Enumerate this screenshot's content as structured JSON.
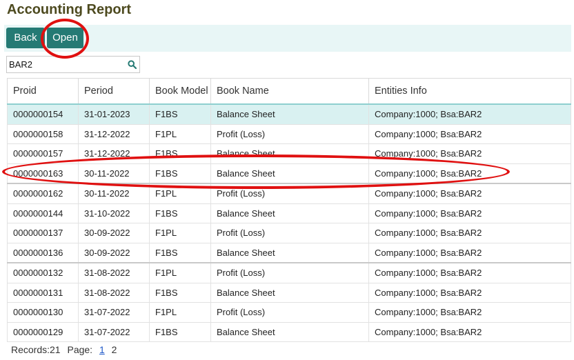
{
  "page": {
    "title": "Accounting Report"
  },
  "toolbar": {
    "back_label": "Back",
    "open_label": "Open"
  },
  "search": {
    "value": "BAR2"
  },
  "table": {
    "columns": [
      "Proid",
      "Period",
      "Book Model",
      "Book Name",
      "Entities Info"
    ],
    "rows": [
      [
        "0000000154",
        "31-01-2023",
        "F1BS",
        "Balance Sheet",
        "Company:1000; Bsa:BAR2"
      ],
      [
        "0000000158",
        "31-12-2022",
        "F1PL",
        "Profit (Loss)",
        "Company:1000; Bsa:BAR2"
      ],
      [
        "0000000157",
        "31-12-2022",
        "F1BS",
        "Balance Sheet",
        "Company:1000; Bsa:BAR2"
      ],
      [
        "0000000163",
        "30-11-2022",
        "F1BS",
        "Balance Sheet",
        "Company:1000; Bsa:BAR2"
      ],
      [
        "0000000162",
        "30-11-2022",
        "F1PL",
        "Profit (Loss)",
        "Company:1000; Bsa:BAR2"
      ],
      [
        "0000000144",
        "31-10-2022",
        "F1BS",
        "Balance Sheet",
        "Company:1000; Bsa:BAR2"
      ],
      [
        "0000000137",
        "30-09-2022",
        "F1PL",
        "Profit (Loss)",
        "Company:1000; Bsa:BAR2"
      ],
      [
        "0000000136",
        "30-09-2022",
        "F1BS",
        "Balance Sheet",
        "Company:1000; Bsa:BAR2"
      ],
      [
        "0000000132",
        "31-08-2022",
        "F1PL",
        "Profit (Loss)",
        "Company:1000; Bsa:BAR2"
      ],
      [
        "0000000131",
        "31-08-2022",
        "F1BS",
        "Balance Sheet",
        "Company:1000; Bsa:BAR2"
      ],
      [
        "0000000130",
        "31-07-2022",
        "F1PL",
        "Profit (Loss)",
        "Company:1000; Bsa:BAR2"
      ],
      [
        "0000000129",
        "31-07-2022",
        "F1BS",
        "Balance Sheet",
        "Company:1000; Bsa:BAR2"
      ]
    ]
  },
  "footer": {
    "records_label": "Records:21",
    "page_label": "Page:",
    "pages": [
      "1",
      "2"
    ]
  },
  "colors": {
    "accent": "#257a74",
    "selected_row": "#d9f1f1",
    "annotation": "#e01010"
  }
}
